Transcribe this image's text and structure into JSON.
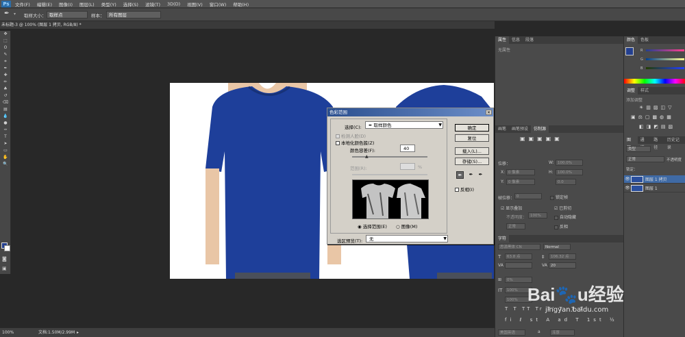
{
  "menubar": {
    "logo": "Ps",
    "items": [
      "文件(F)",
      "编辑(E)",
      "图像(I)",
      "图层(L)",
      "类型(Y)",
      "选择(S)",
      "滤镜(T)",
      "3D(D)",
      "视图(V)",
      "窗口(W)",
      "帮助(H)"
    ]
  },
  "options": {
    "sample_size_label": "取样大小：",
    "sample_size_value": "取样点",
    "sample_label": "样本：",
    "sample_value": "所有图层"
  },
  "document_tab": "未标题-3 @ 100% (图层 1 拷贝, RGB/8) *",
  "toolbar_icons": [
    "move-icon",
    "marquee-icon",
    "lasso-icon",
    "quick-select-icon",
    "crop-icon",
    "eyedropper-icon",
    "healing-icon",
    "brush-icon",
    "stamp-icon",
    "history-brush-icon",
    "eraser-icon",
    "gradient-icon",
    "blur-icon",
    "dodge-icon",
    "pen-icon",
    "type-icon",
    "path-select-icon",
    "shape-icon",
    "hand-icon",
    "zoom-icon"
  ],
  "toolbar_glyphs": [
    "✥",
    "⬚",
    "ʘ",
    "✎",
    "⌗",
    "✒",
    "✚",
    "✏",
    "♣",
    "↺",
    "⌫",
    "▤",
    "💧",
    "●",
    "✑",
    "T",
    "➤",
    "▭",
    "✋",
    "🔍"
  ],
  "status": {
    "zoom": "100%",
    "doc": "文档:1.50M/2.99M"
  },
  "dialog": {
    "title": "色彩范围",
    "select_label": "选择(C):",
    "select_value": "取样颜色",
    "detect_faces": "检测人脸(D)",
    "localized": "本地化颜色簇(Z)",
    "fuzziness_label": "颜色容差(F):",
    "fuzziness_value": "40",
    "range_label": "范围(R):",
    "range_unit": "%",
    "radio_selection": "选择范围(E)",
    "radio_image": "图像(M)",
    "preview_label": "选区预览(T):",
    "preview_value": "无",
    "ok": "确定",
    "reset": "复位",
    "load": "载入(L)...",
    "save": "存储(S)...",
    "invert": "反相(I)"
  },
  "properties_panel": {
    "tabs": [
      "属性",
      "信息",
      "段落"
    ],
    "content": "无属性"
  },
  "color_panel": {
    "tabs": [
      "颜色",
      "色板"
    ],
    "labels": [
      "R",
      "G",
      "B"
    ]
  },
  "adjustments_panel": {
    "tabs": [
      "调整",
      "样式"
    ],
    "title": "添加调整"
  },
  "paragraph_panel": {
    "tabs": [
      "画笔",
      "画笔预设",
      "仿制源"
    ],
    "offset_label": "位移：",
    "x_label": "X:",
    "x_value": "0 像素",
    "y_label": "Y:",
    "y_value": "0 像素",
    "w_label": "W:",
    "w_value": "100.0%",
    "h_label": "H:",
    "h_value": "100.0%",
    "angle_value": "0.0",
    "frame_label": "帧位移：",
    "frame_value": "0",
    "lock_frame": "锁定帧",
    "show_overlay": "显示叠加",
    "opacity_label": "不透明度：",
    "opacity_value": "100%",
    "mode_value": "正常",
    "clipped": "已剪切",
    "auto_hide": "自动隐藏",
    "invert": "反相"
  },
  "character_panel": {
    "tab": "字符",
    "font": "思源黑体 CN",
    "style": "Normal",
    "size": "63.8 点",
    "leading": "106.32 点",
    "tracking": "20",
    "scale": "0%",
    "vscale": "100%",
    "hscale": "100%",
    "language": "美国英语",
    "aa": "浑厚",
    "aa_prefix": "a"
  },
  "layers_panel": {
    "tabs": [
      "图层",
      "通道",
      "路径",
      "历史记录"
    ],
    "kind": "类型",
    "mode": "正常",
    "opacity_label": "不透明度",
    "lock_label": "锁定：",
    "layers": [
      "图层 1 拷贝",
      "图层 1"
    ]
  },
  "colors": {
    "accent": "#3f6aa5",
    "shirt": "#1e3f9a",
    "fg": "#233f8f",
    "bg": "#ffffff"
  },
  "watermark": "Baidu经验 jingyan.baidu.com"
}
